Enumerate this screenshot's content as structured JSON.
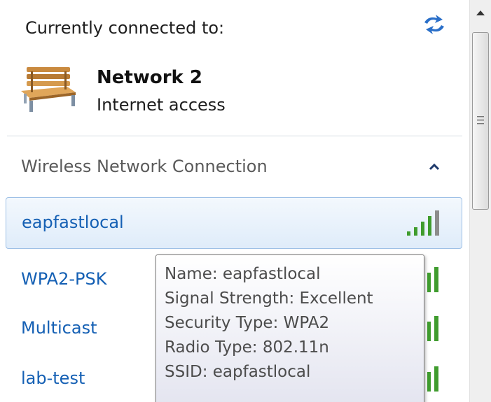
{
  "header": {
    "connected_label": "Currently connected to:",
    "network_name": "Network  2",
    "network_status": "Internet access"
  },
  "section": {
    "label": "Wireless Network Connection"
  },
  "networks": [
    {
      "label": "eapfastlocal",
      "selected": true
    },
    {
      "label": "WPA2-PSK"
    },
    {
      "label": "Multicast"
    },
    {
      "label": "lab-test"
    }
  ],
  "tooltip": {
    "lines": [
      "Name: eapfastlocal",
      "Signal Strength: Excellent",
      "Security Type: WPA2",
      "Radio Type: 802.11n",
      "SSID: eapfastlocal"
    ]
  },
  "icons": {
    "refresh": "refresh-icon",
    "network_type": "bench-icon",
    "collapse": "chevron-up-icon",
    "signal": "signal-strength-icon"
  },
  "colors": {
    "link": "#1560b4",
    "signal_green": "#3f9c2e",
    "selection_border": "#9ec0e6"
  }
}
